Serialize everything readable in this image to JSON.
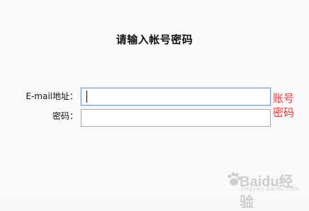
{
  "title": "请输入帐号密码",
  "form": {
    "email_label": "E-mail地址：",
    "email_value": "",
    "password_label": "密码：",
    "password_value": ""
  },
  "hint": {
    "text": "账号密码",
    "color": "#e53a2f"
  },
  "watermark": {
    "brand": "Baidu经验",
    "url": "jingyan.baidu.com"
  }
}
